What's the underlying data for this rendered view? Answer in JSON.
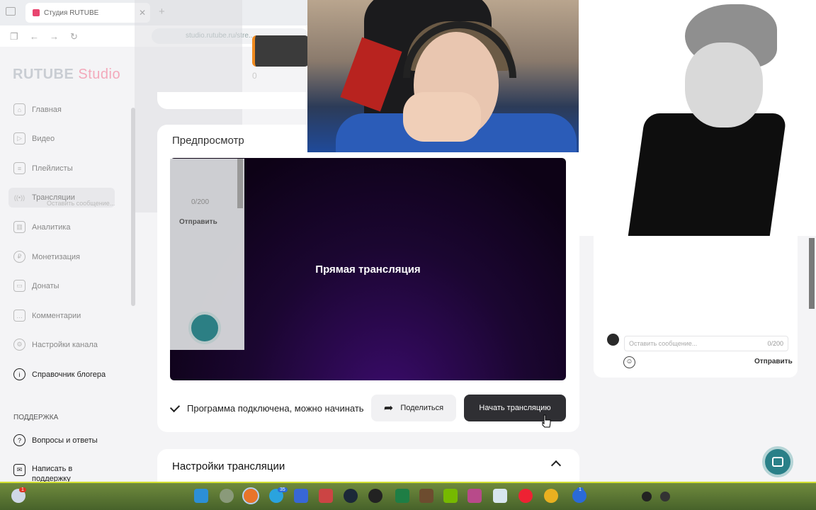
{
  "browser": {
    "tab_title": "Студия RUTUBE",
    "url": "studio.rutube.ru/stre..."
  },
  "header": {
    "logo_main": "RUTUBE",
    "logo_sub": "Studio",
    "counter": "0"
  },
  "sidebar": {
    "items": [
      {
        "label": "Главная",
        "icon": "home-icon"
      },
      {
        "label": "Видео",
        "icon": "video-icon"
      },
      {
        "label": "Плейлисты",
        "icon": "playlist-icon"
      },
      {
        "label": "Трансляции",
        "icon": "broadcast-icon"
      },
      {
        "label": "Аналитика",
        "icon": "analytics-icon"
      },
      {
        "label": "Монетизация",
        "icon": "money-icon"
      },
      {
        "label": "Донаты",
        "icon": "donate-icon"
      },
      {
        "label": "Комментарии",
        "icon": "comment-icon"
      },
      {
        "label": "Настройки канала",
        "icon": "settings-icon"
      },
      {
        "label": "Справочник блогера",
        "icon": "info-icon"
      }
    ],
    "support_title": "ПОДДЕРЖКА",
    "support_items": [
      {
        "label": "Вопросы и ответы",
        "icon": "help-icon"
      },
      {
        "label": "Написать в поддержку",
        "icon": "mail-icon"
      }
    ]
  },
  "preview": {
    "title": "Предпросмотр",
    "player_label": "Прямая трансляция",
    "status_text": "Программа подключена, можно начинать",
    "share_label": "Поделиться",
    "start_label": "Начать трансляцию"
  },
  "settings": {
    "title": "Настройки трансляции"
  },
  "ghost_chat": {
    "placeholder": "Оставить сообщение...",
    "count": "0/200",
    "send": "Отправить"
  },
  "chat": {
    "placeholder": "Оставить сообщение...",
    "count": "0/200",
    "send": "Отправить"
  },
  "taskbar": {
    "badges": [
      "1",
      "35",
      "1"
    ]
  },
  "colors": {
    "accent_dark": "#2f2f33",
    "fab_teal": "#2a8088",
    "logo_pink": "#f3a9bb"
  }
}
